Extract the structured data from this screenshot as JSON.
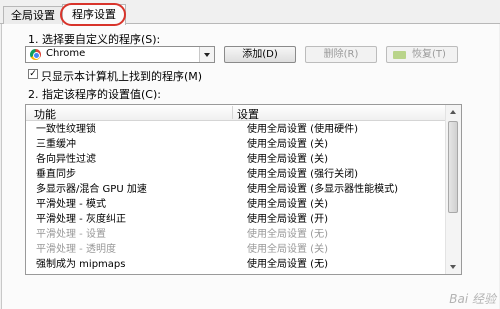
{
  "tabs": [
    "全局设置",
    "程序设置"
  ],
  "section1": {
    "label": "1. 选择要自定义的程序(S):"
  },
  "program_select": {
    "value": "Chrome",
    "icon": "chrome-icon"
  },
  "buttons": {
    "add": "添加(D)",
    "remove": "删除(R)",
    "restore": "恢复(T)"
  },
  "show_only": {
    "label": "只显示本计算机上找到的程序(M)",
    "checked": true
  },
  "section2": {
    "label": "2. 指定该程序的设置值(C):"
  },
  "table": {
    "columns": [
      "功能",
      "设置"
    ],
    "rows": [
      {
        "feature": "一致性纹理锁",
        "setting": "使用全局设置 (使用硬件)",
        "disabled": false
      },
      {
        "feature": "三重缓冲",
        "setting": "使用全局设置 (关)",
        "disabled": false
      },
      {
        "feature": "各向异性过滤",
        "setting": "使用全局设置 (关)",
        "disabled": false
      },
      {
        "feature": "垂直同步",
        "setting": "使用全局设置 (强行关闭)",
        "disabled": false
      },
      {
        "feature": "多显示器/混合 GPU 加速",
        "setting": "使用全局设置 (多显示器性能模式)",
        "disabled": false
      },
      {
        "feature": "平滑处理 - 模式",
        "setting": "使用全局设置 (关)",
        "disabled": false
      },
      {
        "feature": "平滑处理 - 灰度纠正",
        "setting": "使用全局设置 (开)",
        "disabled": false
      },
      {
        "feature": "平滑处理 - 设置",
        "setting": "使用全局设置 (无)",
        "disabled": true
      },
      {
        "feature": "平滑处理 - 透明度",
        "setting": "使用全局设置 (关)",
        "disabled": true
      },
      {
        "feature": "强制成为 mipmaps",
        "setting": "使用全局设置 (无)",
        "disabled": false
      }
    ]
  },
  "watermark": "Bai 经验",
  "colors": {
    "highlight": "#d8342b",
    "disabled_text": "#999999"
  }
}
